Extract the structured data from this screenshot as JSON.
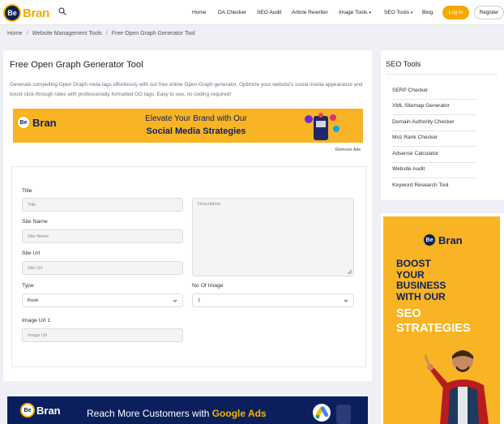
{
  "header": {
    "logo_be": "Be",
    "logo_bran": "Bran",
    "nav": [
      "Home",
      "DA Checker",
      "SEO Audit",
      "Article Rewriter",
      "Image Tools",
      "SEO Tools",
      "Blog"
    ],
    "login": "Log in",
    "register": "Register"
  },
  "breadcrumb": [
    "Home",
    "Website Management Tools",
    "Free Open Graph Generator Tool"
  ],
  "main": {
    "title": "Free Open Graph Generator Tool",
    "description": "Generate compelling Open Graph meta tags effortlessly with our free online Open Graph generator. Optimize your website's social media appearance and boost click-through rates with professionally formatted OG tags. Easy to use, no coding required!",
    "banner_line1": "Elevate Your Brand with Our",
    "banner_line2": "Social Media Strategies",
    "remove_ads": "Remove Ads"
  },
  "form": {
    "title_label": "Title",
    "title_placeholder": "Title",
    "description_placeholder": "Description",
    "site_name_label": "Site Name",
    "site_name_placeholder": "Site Name",
    "site_url_label": "Site Url",
    "site_url_placeholder": "Site Url",
    "type_label": "Type",
    "type_value": "Book",
    "no_of_image_label": "No Of Image",
    "no_of_image_value": "1",
    "image_url_label": "Image Url 1",
    "image_url_placeholder": "Image Url"
  },
  "bottom_banner": {
    "text": "Reach More Customers with ",
    "highlight": "Google Ads"
  },
  "sidebar": {
    "title": "SEO Tools",
    "items": [
      "SERP Checker",
      "XML Sitemap Generator",
      "Domain Authority Checker",
      "Moz Rank Checker",
      "Adsense Calculator",
      "Website Audit",
      "Keyword Research Tool"
    ]
  },
  "side_ad": {
    "line1": "BOOST",
    "line2": "YOUR",
    "line3": "BUSINESS",
    "line4": "WITH OUR",
    "seo": "SEO",
    "strategies": "STRATEGIES"
  }
}
